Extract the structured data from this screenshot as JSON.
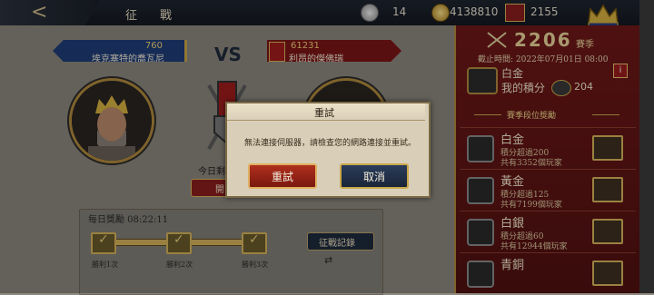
{
  "topbar": {
    "back_icon": "back-arrow-icon",
    "title": "征　戰",
    "silver": "14",
    "gold": "4138810",
    "banner_count": "2155"
  },
  "battle": {
    "vs": "VS",
    "player": {
      "points": "760",
      "name": "埃克塞特的喬瓦尼"
    },
    "enemy": {
      "points": "61231",
      "name": "利昂的傑佛瑞"
    },
    "today_label": "今日剩餘",
    "attack_label": "開"
  },
  "daily": {
    "title": "每日獎勵 08:22:11",
    "wins": [
      "勝利1次",
      "勝利2次",
      "勝利3次"
    ],
    "record_label": "征戰記錄"
  },
  "season": {
    "points": "2206",
    "label": "賽季",
    "deadline": "截止時間: 2022年07月01日 08:00",
    "rank": "白金",
    "my_points_label": "我的積分",
    "my_points": "204",
    "info": "i",
    "rewards_title": "賽季段位獎勵",
    "tiers": [
      {
        "name": "白金",
        "req": "積分超過200",
        "count": "共有3352個玩家"
      },
      {
        "name": "黃金",
        "req": "積分超過125",
        "count": "共有7199個玩家"
      },
      {
        "name": "白銀",
        "req": "積分超過60",
        "count": "共有12944個玩家"
      },
      {
        "name": "青銅",
        "req": "",
        "count": ""
      }
    ]
  },
  "modal": {
    "title": "重試",
    "message": "無法連接伺服器，請檢查您的網路連接並重試。",
    "retry_label": "重試",
    "cancel_label": "取消"
  },
  "colors": {
    "panel_red": "#6e1818",
    "gold_trim": "#b08a3e",
    "player_blue": "#1f3d78",
    "enemy_red": "#7a1616"
  }
}
